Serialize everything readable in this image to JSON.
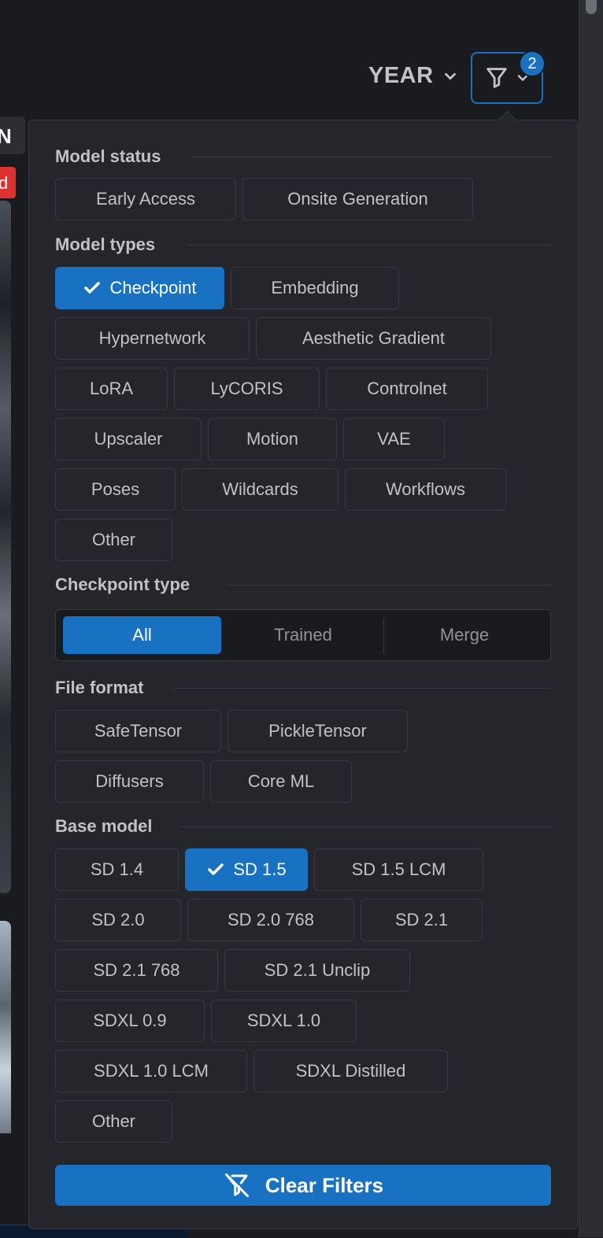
{
  "header": {
    "sort_label": "YEAR",
    "filter_badge_count": "2"
  },
  "peek": {
    "letter": "N",
    "badge_letter": "d"
  },
  "filters": {
    "model_status": {
      "title": "Model status",
      "options": [
        "Early Access",
        "Onsite Generation"
      ]
    },
    "model_types": {
      "title": "Model types",
      "options": [
        "Checkpoint",
        "Embedding",
        "Hypernetwork",
        "Aesthetic Gradient",
        "LoRA",
        "LyCORIS",
        "Controlnet",
        "Upscaler",
        "Motion",
        "VAE",
        "Poses",
        "Wildcards",
        "Workflows",
        "Other"
      ],
      "selected": [
        "Checkpoint"
      ]
    },
    "checkpoint_type": {
      "title": "Checkpoint type",
      "options": [
        "All",
        "Trained",
        "Merge"
      ],
      "selected": "All"
    },
    "file_format": {
      "title": "File format",
      "options": [
        "SafeTensor",
        "PickleTensor",
        "Diffusers",
        "Core ML"
      ]
    },
    "base_model": {
      "title": "Base model",
      "options": [
        "SD 1.4",
        "SD 1.5",
        "SD 1.5 LCM",
        "SD 2.0",
        "SD 2.0 768",
        "SD 2.1",
        "SD 2.1 768",
        "SD 2.1 Unclip",
        "SDXL 0.9",
        "SDXL 1.0",
        "SDXL 1.0 LCM",
        "SDXL Distilled",
        "Other"
      ],
      "selected": [
        "SD 1.5"
      ]
    },
    "clear_label": "Clear Filters"
  },
  "colors": {
    "accent": "#1971c2",
    "surface": "#25262b",
    "border": "#373a40",
    "background": "#1a1b1e",
    "danger": "#e03131"
  },
  "icons": {
    "sort_chevron": "chevron-down-icon",
    "filter": "filter-icon",
    "clear": "filter-off-icon",
    "check": "check-icon"
  }
}
